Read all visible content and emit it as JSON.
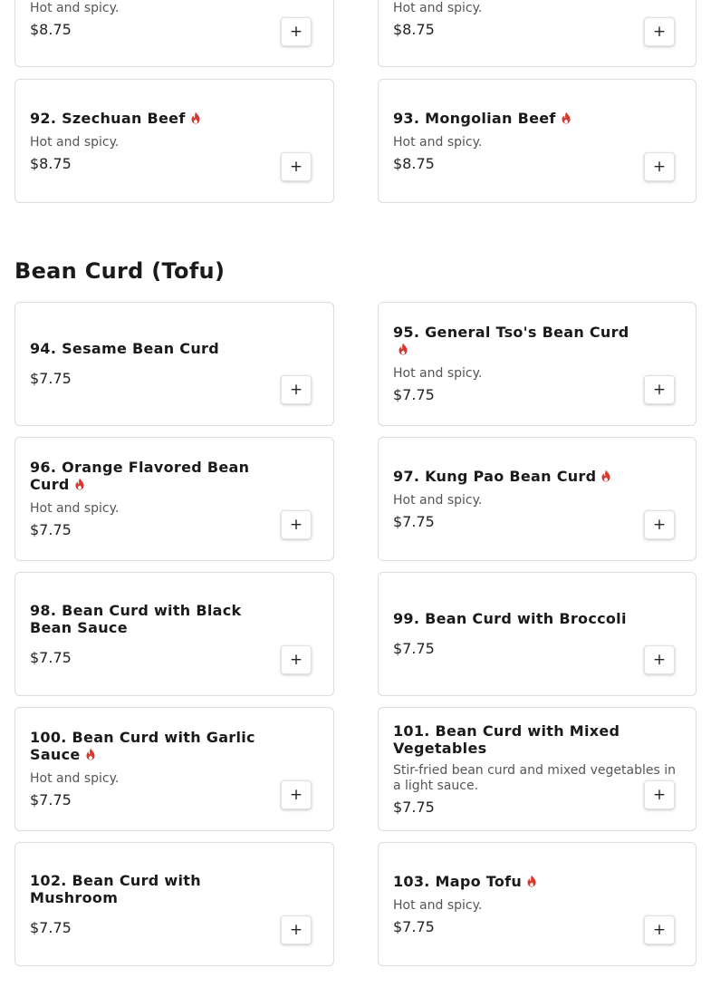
{
  "colors": {
    "spicy_icon": "#d43a2f",
    "card_border": "#dcdcdc"
  },
  "top_partial": [
    {
      "desc": "Hot and spicy.",
      "price": "$8.75",
      "button": "+"
    },
    {
      "desc": "Hot and spicy.",
      "price": "$8.75",
      "button": "+"
    }
  ],
  "beef_items": [
    {
      "name": "92. Szechuan Beef",
      "spicy": true,
      "desc": "Hot and spicy.",
      "price": "$8.75",
      "button": "+"
    },
    {
      "name": "93. Mongolian Beef",
      "spicy": true,
      "desc": "Hot and spicy.",
      "price": "$8.75",
      "button": "+"
    }
  ],
  "bean_curd_section": {
    "title": "Bean Curd (Tofu)",
    "items": [
      {
        "name": "94. Sesame Bean Curd",
        "spicy": false,
        "desc": "",
        "price": "$7.75",
        "button": "+"
      },
      {
        "name": "95. General Tso's Bean Curd",
        "spicy": true,
        "desc": "Hot and spicy.",
        "price": "$7.75",
        "button": "+"
      },
      {
        "name": "96. Orange Flavored Bean Curd",
        "spicy": true,
        "desc": "Hot and spicy.",
        "price": "$7.75",
        "button": "+"
      },
      {
        "name": "97. Kung Pao Bean Curd",
        "spicy": true,
        "desc": "Hot and spicy.",
        "price": "$7.75",
        "button": "+"
      },
      {
        "name": "98. Bean Curd with Black Bean Sauce",
        "spicy": false,
        "desc": "",
        "price": "$7.75",
        "button": "+"
      },
      {
        "name": "99. Bean Curd with Broccoli",
        "spicy": false,
        "desc": "",
        "price": "$7.75",
        "button": "+"
      },
      {
        "name": "100. Bean Curd with Garlic Sauce",
        "spicy": true,
        "desc": "Hot and spicy.",
        "price": "$7.75",
        "button": "+"
      },
      {
        "name": "101. Bean Curd with Mixed Vegetables",
        "spicy": false,
        "desc": "Stir-fried bean curd and mixed vegetables in a light sauce.",
        "price": "$7.75",
        "button": "+"
      },
      {
        "name": "102. Bean Curd with Mushroom",
        "spicy": false,
        "desc": "",
        "price": "$7.75",
        "button": "+"
      },
      {
        "name": "103. Mapo Tofu",
        "spicy": true,
        "desc": "Hot and spicy.",
        "price": "$7.75",
        "button": "+"
      }
    ]
  }
}
